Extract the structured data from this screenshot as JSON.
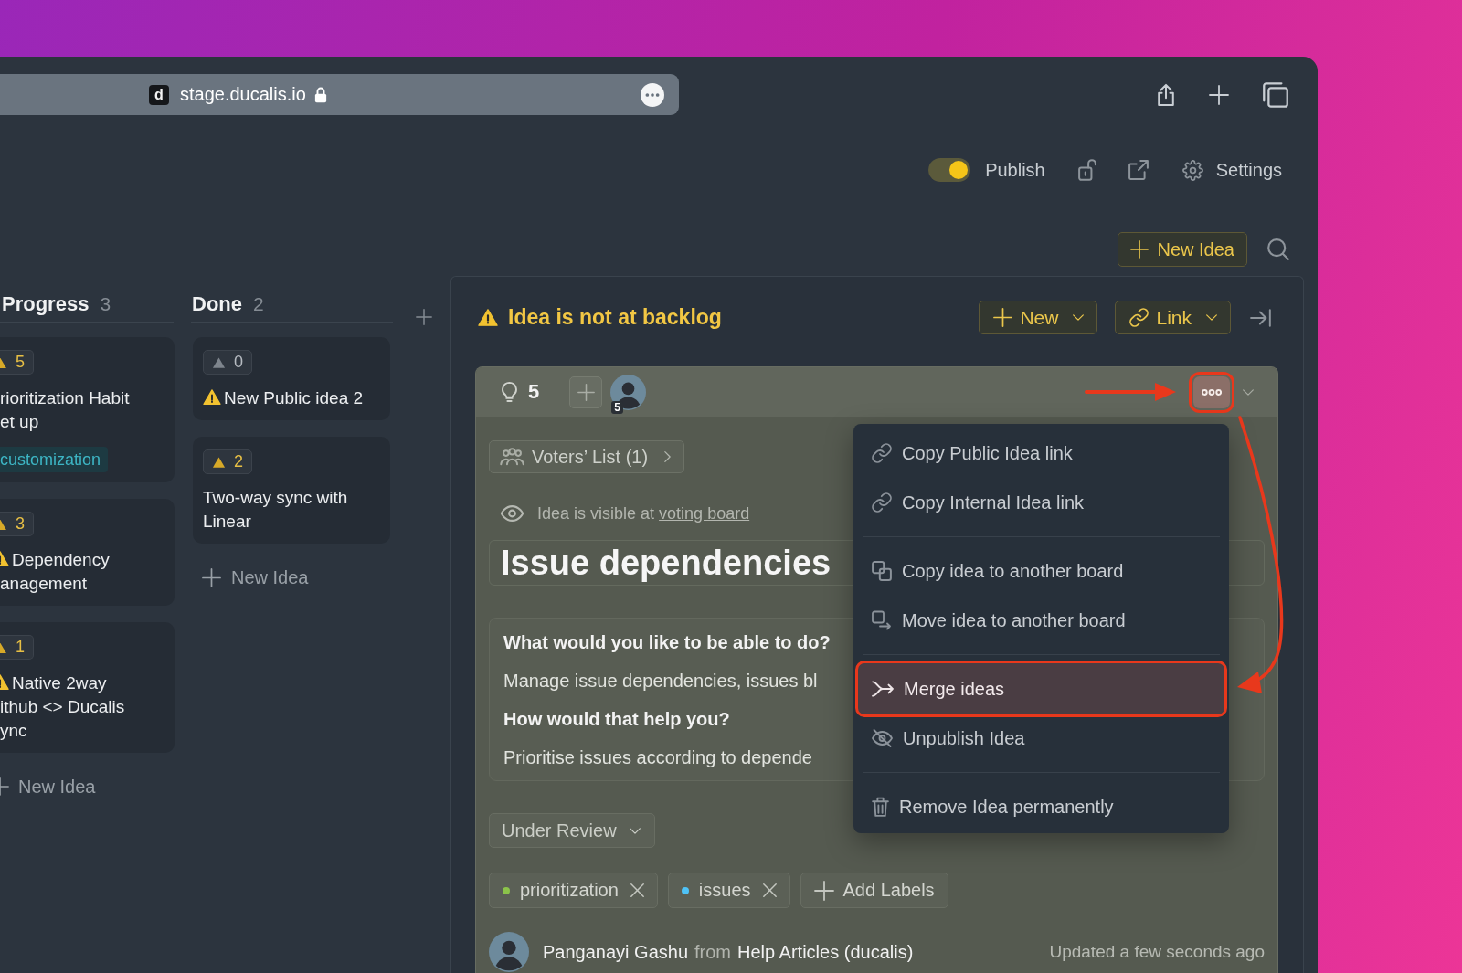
{
  "browser": {
    "favicon": "d",
    "url": "stage.ducalis.io"
  },
  "header": {
    "publish": {
      "label": "Publish",
      "on": true
    },
    "settings": "Settings",
    "new_idea": "New Idea"
  },
  "board": {
    "columns": [
      {
        "title": "Progress",
        "count": "3",
        "cards": [
          {
            "votes": "5",
            "active": true,
            "warning": false,
            "title": "rioritization Habit\net up",
            "labels": [
              "customization"
            ]
          },
          {
            "votes": "3",
            "active": true,
            "warning": true,
            "title": "Dependency\nanagement"
          },
          {
            "votes": "1",
            "active": true,
            "warning": true,
            "title": "Native 2way\nithub <> Ducalis\nync"
          }
        ],
        "add": "New Idea"
      },
      {
        "title": "Done",
        "count": "2",
        "cards": [
          {
            "votes": "0",
            "active": false,
            "warning": true,
            "title": "New Public idea 2"
          },
          {
            "votes": "2",
            "active": true,
            "warning": false,
            "title": "Two-way sync with\nLinear"
          }
        ],
        "add": "New Idea"
      }
    ]
  },
  "panel": {
    "status": "Idea is not at backlog",
    "actions": [
      {
        "kind": "add",
        "label": "New"
      },
      {
        "kind": "link",
        "label": "Link"
      }
    ],
    "idea": {
      "votes": "5",
      "voter_count": "5",
      "more_highlighted": true,
      "voters_list": "Voters’ List (1)",
      "visibility": {
        "text": "Idea is visible at",
        "link": "voting board"
      },
      "title": "Issue dependencies",
      "description": [
        {
          "kind": "question",
          "text": "What would you like to be able to do?"
        },
        {
          "kind": "answer",
          "text": "Manage issue dependencies, issues bl"
        },
        {
          "kind": "question",
          "text": "How would that help you?"
        },
        {
          "kind": "answer",
          "text": "Prioritise issues according to depende"
        }
      ],
      "status": "Under Review",
      "labels": [
        {
          "name": "prioritization",
          "color": "#8bc34a"
        },
        {
          "name": "issues",
          "color": "#4fc3f7"
        }
      ],
      "add_labels": "Add Labels",
      "author": "Panganayi Gashu",
      "from": "from",
      "source": "Help Articles (ducalis)",
      "updated": "Updated a few seconds ago",
      "menu": {
        "groups": [
          {
            "items": [
              {
                "kind": "link",
                "label": "Copy Public Idea link",
                "highlighted": false
              },
              {
                "kind": "link",
                "label": "Copy Internal Idea link",
                "highlighted": false
              }
            ]
          },
          {
            "items": [
              {
                "kind": "copy",
                "label": "Copy idea to another board",
                "highlighted": false
              },
              {
                "kind": "move",
                "label": "Move idea to another board",
                "highlighted": false
              }
            ]
          },
          {
            "items": [
              {
                "kind": "merge",
                "label": "Merge ideas",
                "highlighted": true
              },
              {
                "kind": "hide",
                "label": "Unpublish Idea",
                "highlighted": false
              }
            ]
          },
          {
            "items": [
              {
                "kind": "trash",
                "label": "Remove Idea permanently",
                "highlighted": false
              }
            ]
          }
        ]
      }
    }
  }
}
